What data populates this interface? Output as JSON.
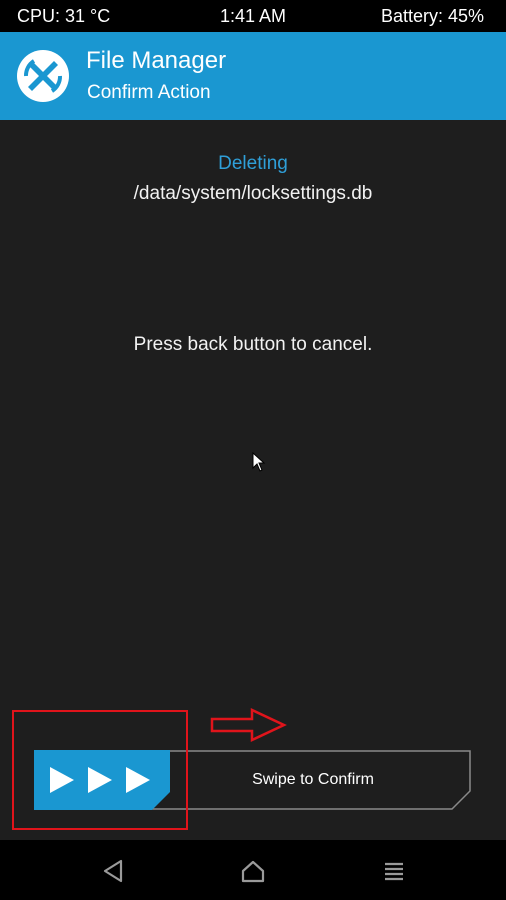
{
  "status_bar": {
    "cpu": "CPU: 31 °C",
    "time": "1:41 AM",
    "battery": "Battery: 45%"
  },
  "header": {
    "title": "File Manager",
    "subtitle": "Confirm Action",
    "logo_icon": "twrp-logo-icon",
    "background_color": "#1a97d1"
  },
  "main": {
    "action_label": "Deleting",
    "target_path": "/data/system/locksettings.db",
    "cancel_hint": "Press back button to cancel."
  },
  "slider": {
    "label": "Swipe to Confirm",
    "handle_icon": "triple-play-arrows-icon",
    "accent_color": "#1a97d1"
  },
  "annotations": {
    "highlight_color": "#e0141b",
    "arrow_icon": "right-arrow-outline-icon"
  },
  "nav_bar": {
    "back_icon": "back-triangle-icon",
    "home_icon": "home-icon",
    "menu_icon": "menu-lines-icon"
  }
}
